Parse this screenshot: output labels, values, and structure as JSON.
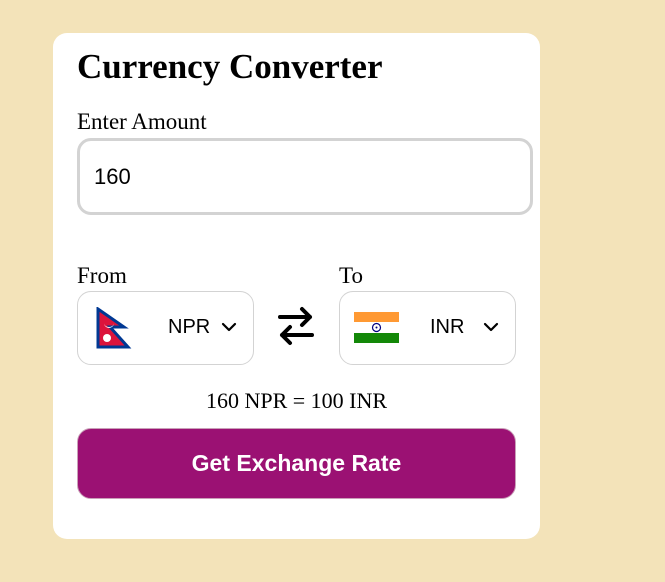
{
  "title": "Currency Converter",
  "amount": {
    "label": "Enter Amount",
    "value": "160"
  },
  "from": {
    "label": "From",
    "code": "NPR",
    "flag": "nepal-flag-icon"
  },
  "to": {
    "label": "To",
    "code": "INR",
    "flag": "india-flag-icon"
  },
  "swap_icon": "swap-arrows-icon",
  "result": "160 NPR = 100 INR",
  "button": "Get Exchange Rate",
  "colors": {
    "page_background": "#f3e3b9",
    "card_background": "#ffffff",
    "button": "#9b1173",
    "nepal_red": "#dc143c",
    "nepal_blue": "#003893",
    "india_saffron": "#ff9933",
    "india_green": "#138808",
    "india_chakra": "#000080"
  }
}
